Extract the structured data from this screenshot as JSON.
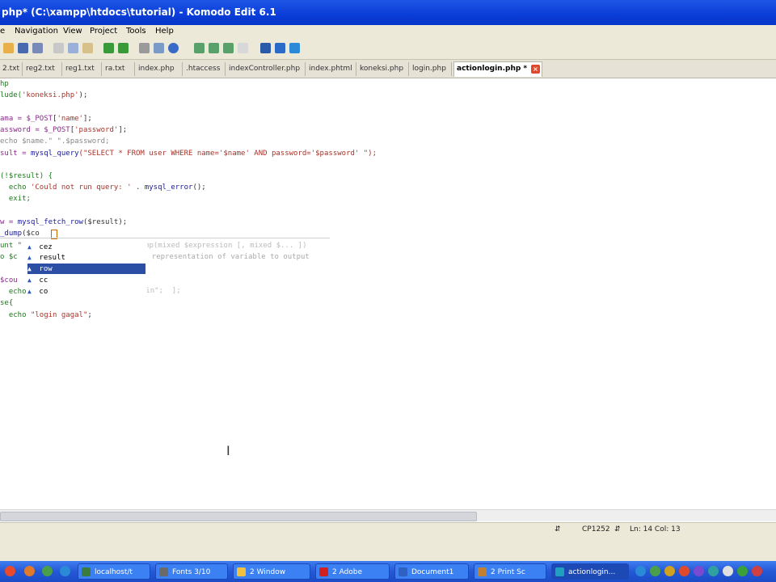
{
  "window": {
    "title": "php* (C:\\xampp\\htdocs\\tutorial) - Komodo Edit 6.1"
  },
  "menu": [
    "e",
    "Navigation",
    "View",
    "Project",
    "Tools",
    "Help"
  ],
  "tabs": [
    {
      "label": "2.txt"
    },
    {
      "label": "reg2.txt"
    },
    {
      "label": "reg1.txt"
    },
    {
      "label": "ra.txt"
    },
    {
      "label": "index.php"
    },
    {
      "label": ".htaccess"
    },
    {
      "label": "indexController.php"
    },
    {
      "label": "index.phtml"
    },
    {
      "label": "koneksi.php"
    },
    {
      "label": "login.php"
    },
    {
      "label": "actionlogin.php *",
      "active": true
    }
  ],
  "code": {
    "l1": "hp",
    "l2a": "lude(",
    "l2b": "'koneksi.php'",
    "l2c": ");",
    "l4a": "ama = ",
    "l4b": "$_POST",
    "l4c": "[",
    "l4d": "'name'",
    "l4e": "];",
    "l5a": "assword = ",
    "l5b": "$_POST",
    "l5c": "[",
    "l5d": "'password'",
    "l5e": "];",
    "l6": "echo $name.\" \".$password;",
    "l7a": "sult = ",
    "l7b": "mysql_query",
    "l7c": "(\"SELECT * FROM user WHERE name='$name' AND password='$password' \");",
    "l9a": "(!$result) {",
    "l10a": "  echo ",
    "l10b": "'Could not run query: '",
    "l10c": " . ",
    "l10d": "mysql_error",
    "l10e": "();",
    "l11": "  exit;",
    "l13a": "w = ",
    "l13b": "mysql_fetch_row",
    "l13c": "($result);",
    "l14a": "_dump",
    "l14b": "($co",
    "l15": "unt \"",
    "l16": "o $c",
    "l18": "$cou",
    "l19": "  echo",
    "l20": "se{",
    "l21a": "  echo ",
    "l21b": "\"login gagal\"",
    "l21c": ";"
  },
  "calltip": {
    "line1": "mixed var_dump(mixed $expression [, mixed $... ])",
    "line2": "        Dumps string representation of variable to output",
    "line3": "                       ];",
    "line4": "              \"Berhasil login\";  ];"
  },
  "autocomplete": {
    "items": [
      {
        "label": "cez"
      },
      {
        "label": "result"
      },
      {
        "label": "row",
        "selected": true
      },
      {
        "label": "cc"
      },
      {
        "label": "co"
      }
    ]
  },
  "status": {
    "encoding": "CP1252",
    "position": "Ln: 14 Col: 13"
  },
  "taskbar": {
    "items": [
      {
        "label": "localhost/t",
        "color": "#3b7b3b"
      },
      {
        "label": "Fonts 3/10",
        "color": "#6a6a6a"
      },
      {
        "label": "2 Window",
        "color": "#f0c040"
      },
      {
        "label": "2 Adobe",
        "color": "#d02020"
      },
      {
        "label": "Document1",
        "color": "#3060c0"
      },
      {
        "label": "2 Print Sc",
        "color": "#c08030"
      },
      {
        "label": "actionlogin...",
        "color": "#20a0c0",
        "active": true
      }
    ]
  }
}
